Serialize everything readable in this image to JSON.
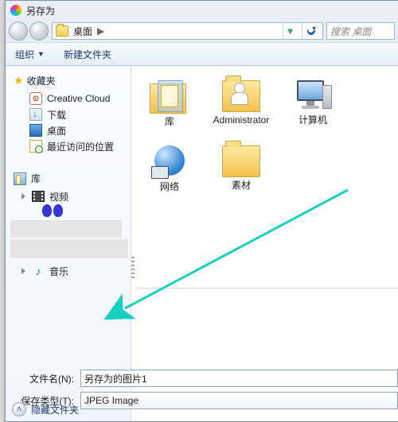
{
  "window": {
    "title": "另存为"
  },
  "nav": {
    "location_icon": "desktop",
    "location_text": "桌面",
    "breadcrumb_arrow": "▶",
    "search_placeholder": "搜索 桌面"
  },
  "toolbar": {
    "organize": "组织",
    "new_folder": "新建文件夹"
  },
  "sidebar": {
    "favorites": {
      "label": "收藏夹",
      "items": [
        {
          "icon": "creative-cloud",
          "label": "Creative Cloud"
        },
        {
          "icon": "download",
          "label": "下载"
        },
        {
          "icon": "desktop",
          "label": "桌面"
        },
        {
          "icon": "recent",
          "label": "最近访问的位置"
        }
      ]
    },
    "libraries": {
      "label": "库",
      "items": [
        {
          "icon": "video",
          "label": "视频",
          "expandable": true
        },
        {
          "icon": "music",
          "label": "音乐",
          "expandable": true
        }
      ]
    }
  },
  "content": {
    "items": [
      {
        "kind": "library",
        "label": "库"
      },
      {
        "kind": "user",
        "label": "Administrator"
      },
      {
        "kind": "computer",
        "label": "计算机"
      },
      {
        "kind": "network",
        "label": "网络"
      },
      {
        "kind": "folder",
        "label": "素材"
      }
    ]
  },
  "form": {
    "filename_label": "文件名(N):",
    "filename_value": "另存为的图片1",
    "filetype_label": "保存类型(T):",
    "filetype_value": "JPEG Image"
  },
  "footer": {
    "hide_folders": "隐藏文件夹"
  }
}
